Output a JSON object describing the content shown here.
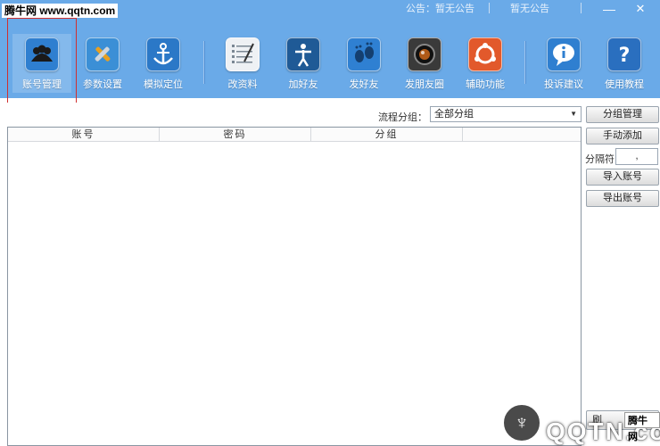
{
  "header": {
    "watermark": "腾牛网 www.qqtn.com",
    "app_title": "",
    "notice_1": "公告：暂无公告",
    "notice_2": "暂无公告",
    "minimize_glyph": "—",
    "close_glyph": "✕"
  },
  "toolbar": {
    "items": [
      {
        "label": "账号管理",
        "icon": "users-icon",
        "color": "#2f7fd0",
        "active": true
      },
      {
        "label": "参数设置",
        "icon": "wrench-icon",
        "color": "#3b8fd6"
      },
      {
        "label": "模拟定位",
        "icon": "anchor-icon",
        "color": "#2b78c7"
      },
      {
        "label": "改资料",
        "icon": "checklist-icon",
        "color": "#7a8793"
      },
      {
        "label": "加好友",
        "icon": "person-icon",
        "color": "#1f5a96"
      },
      {
        "label": "发好友",
        "icon": "footprints-icon",
        "color": "#2f80d2"
      },
      {
        "label": "发朋友圈",
        "icon": "camera-icon",
        "color": "#3a3a3a"
      },
      {
        "label": "辅助功能",
        "icon": "ubuntu-icon",
        "color": "#e2592b"
      },
      {
        "label": "投诉建议",
        "icon": "info-bubble-icon",
        "color": "#2f7fd0"
      },
      {
        "label": "使用教程",
        "icon": "help-icon",
        "color": "#2a6fbf"
      }
    ]
  },
  "filter": {
    "label": "流程分组：",
    "selected": "全部分组",
    "arrow": "▼"
  },
  "side_buttons": {
    "group_manage": "分组管理",
    "manual_add": "手动添加",
    "separator_label": "分隔符",
    "separator_value": ",",
    "import_accounts": "导入账号",
    "export_accounts": "导出账号",
    "bottom_partial": "刷"
  },
  "table": {
    "columns": [
      "账号",
      "密码",
      "分组"
    ]
  },
  "overlay_watermark": {
    "text": "QQTN.com",
    "badge": "腾牛网",
    "logo_glyph": "♆"
  }
}
